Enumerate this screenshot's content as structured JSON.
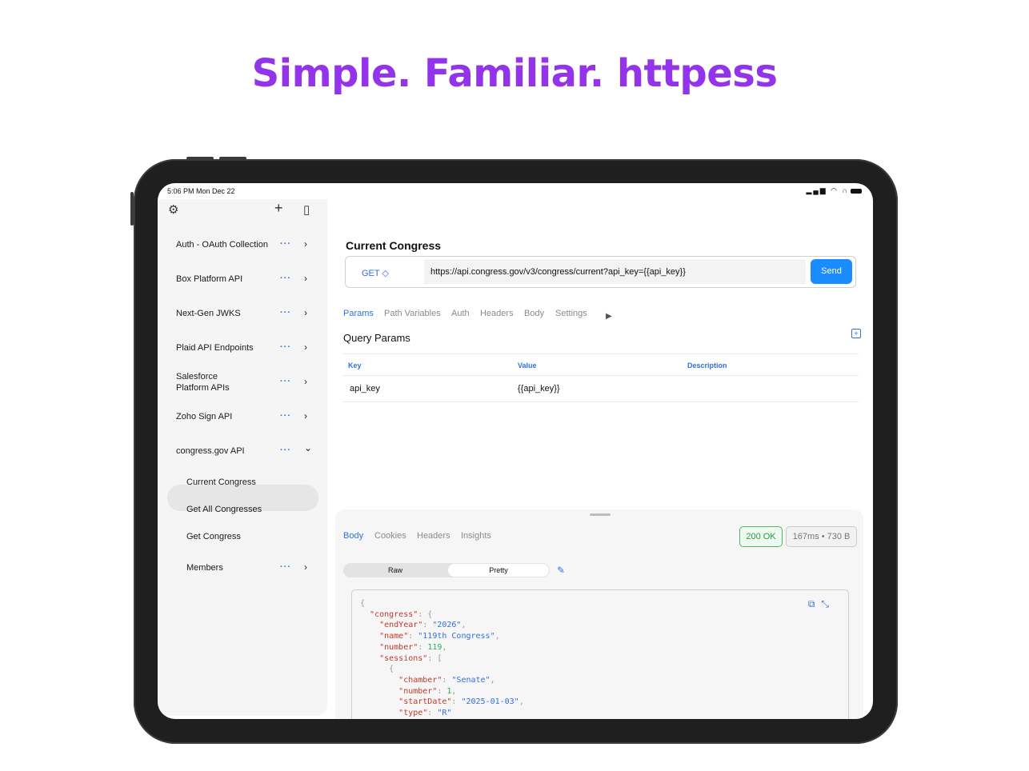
{
  "headline": "Simple. Familiar. httpess",
  "status_bar": {
    "time": "5:06 PM   Mon Dec 22"
  },
  "sidebar": {
    "collections": [
      {
        "label": "Auth - OAuth Collection",
        "dots": "···",
        "chevron": "›"
      },
      {
        "label": "Box Platform API",
        "dots": "···",
        "chevron": "›"
      },
      {
        "label": "Next-Gen JWKS",
        "dots": "···",
        "chevron": "›"
      },
      {
        "label": "Plaid API Endpoints",
        "dots": "···",
        "chevron": "›"
      },
      {
        "label": "Salesforce Platform APIs",
        "dots": "···",
        "chevron": "›"
      },
      {
        "label": "Zoho Sign API",
        "dots": "···",
        "chevron": "›"
      },
      {
        "label": "congress.gov API",
        "dots": "···",
        "chevron": "⌄"
      }
    ],
    "requests": [
      "Current Congress",
      "Get All Congresses",
      "Get Congress"
    ],
    "folder": {
      "label": "Members",
      "dots": "···",
      "chevron": "›"
    }
  },
  "request": {
    "title": "Current Congress",
    "method": "GET ◇",
    "url": "https://api.congress.gov/v3/congress/current?api_key={{api_key}}",
    "send_label": "Send"
  },
  "request_tabs": [
    "Params",
    "Path Variables",
    "Auth",
    "Headers",
    "Body",
    "Settings"
  ],
  "query_params": {
    "title": "Query Params",
    "columns": [
      "Key",
      "Value",
      "Description"
    ],
    "rows": [
      {
        "key": "api_key",
        "value": "{{api_key}}",
        "description": ""
      }
    ]
  },
  "response": {
    "tabs": [
      "Body",
      "Cookies",
      "Headers",
      "Insights"
    ],
    "status": "200 OK",
    "meta": "167ms • 730 B",
    "view_modes": [
      "Raw",
      "Pretty"
    ]
  },
  "icons": {
    "settings": "gear-icon",
    "add": "plus-icon",
    "sidebar_toggle": "sidebar-icon",
    "add_param": "plus-square-icon",
    "edit": "pencil-icon",
    "copy": "copy-icon",
    "expand": "expand-icon"
  },
  "colors": {
    "accent": "#2f6fea",
    "headline": "#9333ea",
    "send": "#1a8cff",
    "success": "#2a9a48"
  }
}
